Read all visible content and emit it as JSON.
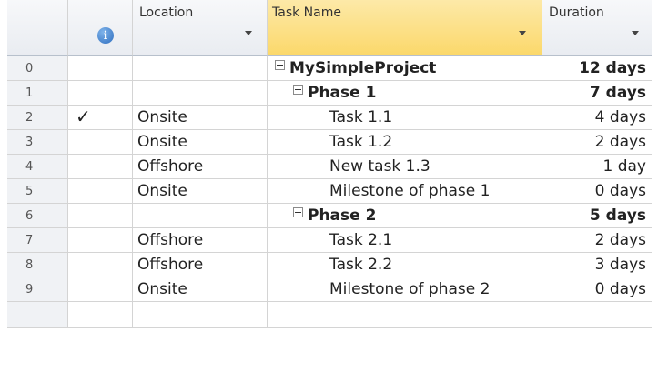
{
  "headers": {
    "location": "Location",
    "task_name": "Task Name",
    "duration": "Duration",
    "info_glyph": "i"
  },
  "rows": [
    {
      "id": "0",
      "indicator": "",
      "location": "",
      "task": "MySimpleProject",
      "duration": "12 days",
      "level": 0,
      "summary": true
    },
    {
      "id": "1",
      "indicator": "",
      "location": "",
      "task": "Phase 1",
      "duration": "7 days",
      "level": 1,
      "summary": true
    },
    {
      "id": "2",
      "indicator": "✓",
      "location": "Onsite",
      "task": "Task 1.1",
      "duration": "4 days",
      "level": 2,
      "summary": false
    },
    {
      "id": "3",
      "indicator": "",
      "location": "Onsite",
      "task": "Task 1.2",
      "duration": "2 days",
      "level": 2,
      "summary": false
    },
    {
      "id": "4",
      "indicator": "",
      "location": "Offshore",
      "task": "New task 1.3",
      "duration": "1 day",
      "level": 2,
      "summary": false
    },
    {
      "id": "5",
      "indicator": "",
      "location": "Onsite",
      "task": "Milestone of phase 1",
      "duration": "0 days",
      "level": 2,
      "summary": false
    },
    {
      "id": "6",
      "indicator": "",
      "location": "",
      "task": "Phase 2",
      "duration": "5 days",
      "level": 1,
      "summary": true
    },
    {
      "id": "7",
      "indicator": "",
      "location": "Offshore",
      "task": "Task 2.1",
      "duration": "2 days",
      "level": 2,
      "summary": false
    },
    {
      "id": "8",
      "indicator": "",
      "location": "Offshore",
      "task": "Task 2.2",
      "duration": "3 days",
      "level": 2,
      "summary": false
    },
    {
      "id": "9",
      "indicator": "",
      "location": "Onsite",
      "task": "Milestone of phase 2",
      "duration": "0 days",
      "level": 2,
      "summary": false
    }
  ],
  "colors": {
    "header_bg": "#e9ecf1",
    "selected_header_bg": "#fbd86a",
    "info_icon": "#2f6fc0",
    "gridline": "#d4d4d4"
  }
}
